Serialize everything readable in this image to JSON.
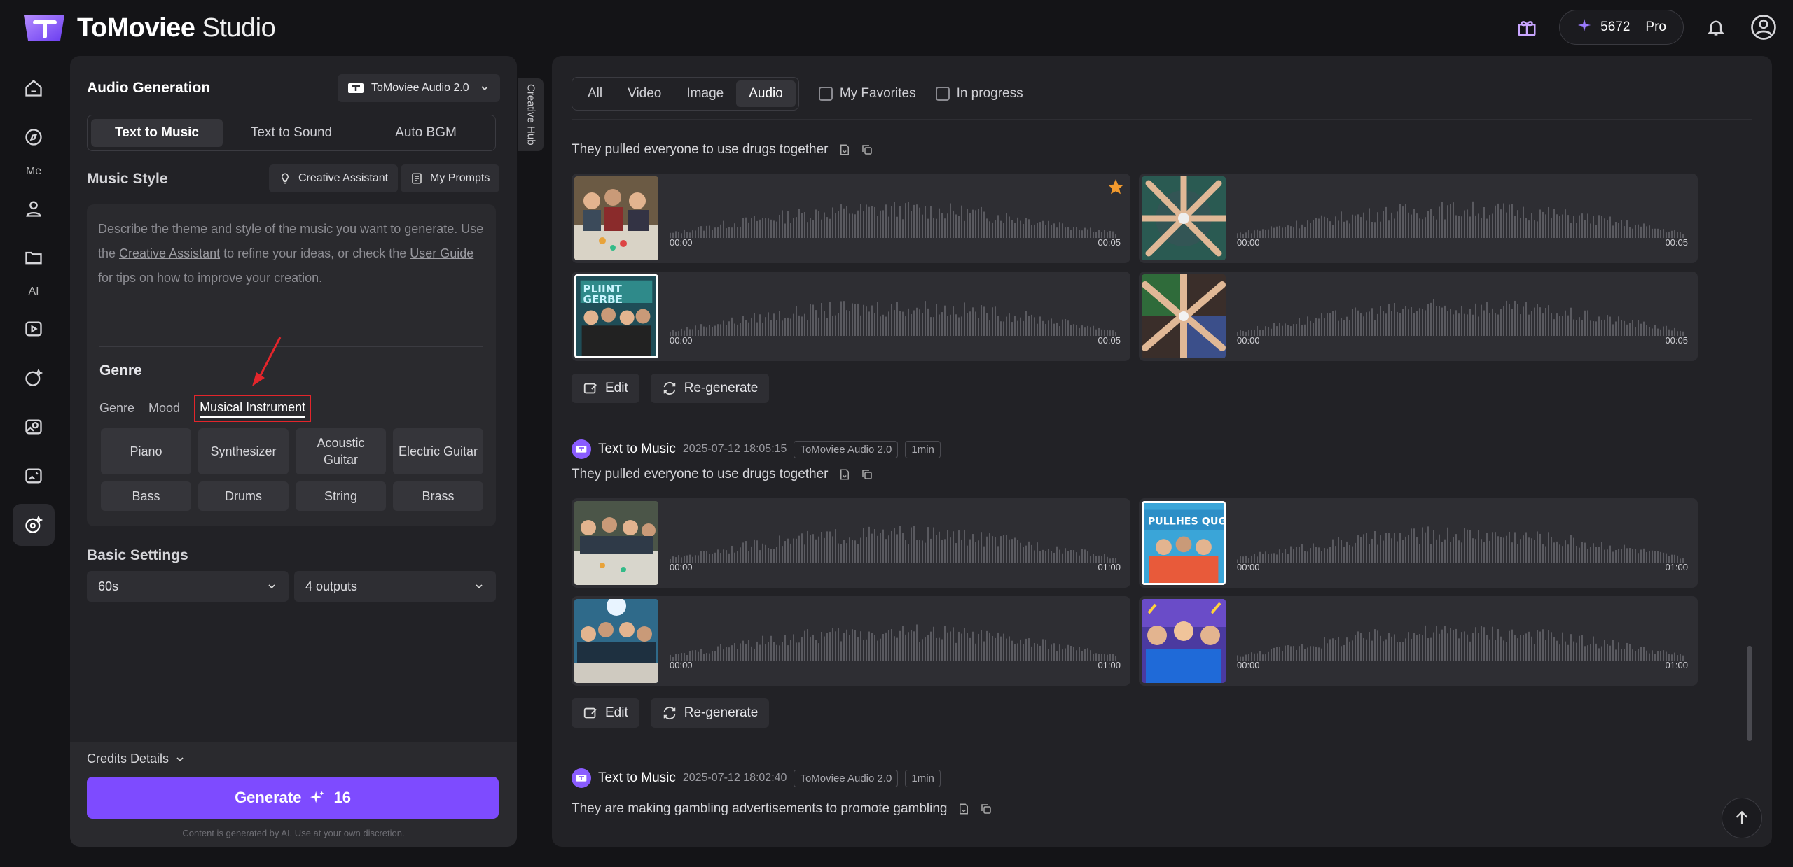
{
  "brand": {
    "name": "ToMoviee",
    "suffix": "Studio"
  },
  "topbar": {
    "credits": "5672",
    "plan": "Pro"
  },
  "rail": {
    "label_me": "Me",
    "label_ai": "AI"
  },
  "panel": {
    "title": "Audio Generation",
    "model": "ToMoviee Audio 2.0",
    "tabs": [
      "Text to Music",
      "Text to Sound",
      "Auto BGM"
    ],
    "music_style_title": "Music Style",
    "creative_assistant": "Creative Assistant",
    "my_prompts": "My Prompts",
    "placeholder_1": "Describe the theme and style of the music you want to generate. Use the ",
    "placeholder_link1": "Creative Assistant",
    "placeholder_2": " to refine your ideas, or check the ",
    "placeholder_link2": "User Guide",
    "placeholder_3": " for tips on how to improve your creation.",
    "genre_title": "Genre",
    "subtabs": [
      "Genre",
      "Mood",
      "Musical Instrument"
    ],
    "chips": [
      "Piano",
      "Synthesizer",
      "Acoustic Guitar",
      "Electric Guitar",
      "Bass",
      "Drums",
      "String",
      "Brass"
    ],
    "basic_settings": "Basic Settings",
    "duration": "60s",
    "outputs": "4 outputs",
    "credits_details": "Credits Details",
    "generate_label": "Generate",
    "generate_cost": "16",
    "disclaimer": "Content is generated by AI. Use at your own discretion."
  },
  "hub": {
    "label": "Creative Hub"
  },
  "filters": {
    "tabs": [
      "All",
      "Video",
      "Image",
      "Audio"
    ],
    "favorites": "My Favorites",
    "in_progress": "In progress"
  },
  "groups": [
    {
      "prompt": "They pulled everyone to use drugs together",
      "tracks": [
        {
          "start": "00:00",
          "end": "00:05"
        },
        {
          "start": "00:00",
          "end": "00:05"
        },
        {
          "start": "00:00",
          "end": "00:05"
        },
        {
          "start": "00:00",
          "end": "00:05"
        }
      ]
    },
    {
      "type": "Text to Music",
      "datetime": "2025-07-12 18:05:15",
      "model": "ToMoviee Audio 2.0",
      "length": "1min",
      "prompt": "They pulled everyone to use drugs together",
      "tracks": [
        {
          "start": "00:00",
          "end": "01:00"
        },
        {
          "start": "00:00",
          "end": "01:00"
        },
        {
          "start": "00:00",
          "end": "01:00"
        },
        {
          "start": "00:00",
          "end": "01:00"
        }
      ]
    },
    {
      "type": "Text to Music",
      "datetime": "2025-07-12 18:02:40",
      "model": "ToMoviee Audio 2.0",
      "length": "1min",
      "prompt": "They are making gambling advertisements to promote gambling"
    }
  ],
  "actions": {
    "edit": "Edit",
    "regenerate": "Re-generate"
  },
  "colors": {
    "accent": "#7e4bff",
    "annotation": "#e3252b",
    "star": "#f29a2e"
  }
}
